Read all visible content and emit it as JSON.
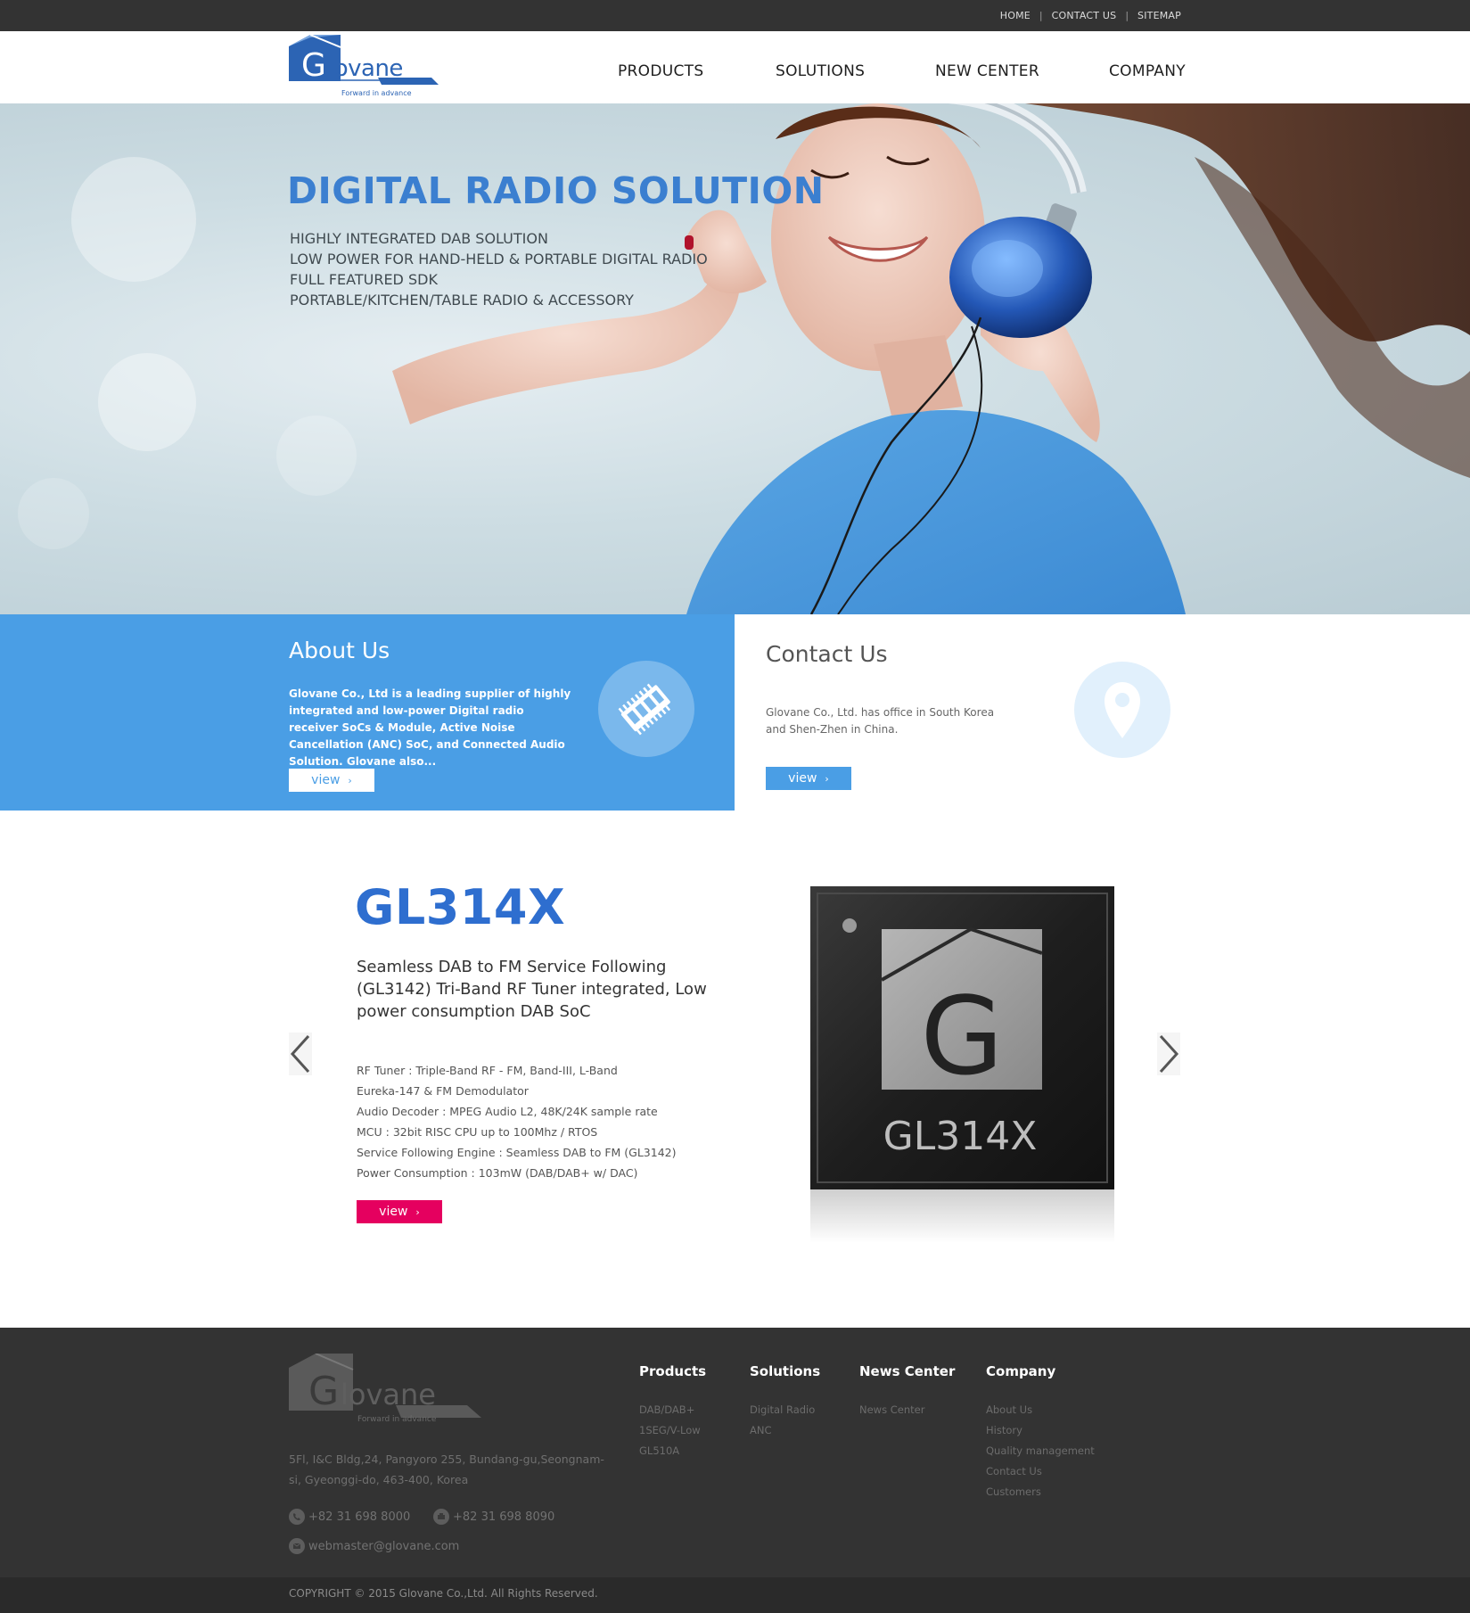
{
  "utility_nav": {
    "home": "HOME",
    "contact": "CONTACT US",
    "sitemap": "SITEMAP",
    "separator": "|"
  },
  "brand": {
    "name": "Glovane",
    "tagline": "Forward in advance",
    "primary_color": "#2c64b4",
    "accent_color": "#4a9ee5"
  },
  "main_nav": [
    "PRODUCTS",
    "SOLUTIONS",
    "NEW CENTER",
    "COMPANY"
  ],
  "hero": {
    "title": "DIGITAL RADIO SOLUTION",
    "lines": [
      "HIGHLY INTEGRATED DAB SOLUTION",
      "LOW POWER FOR HAND-HELD & PORTABLE DIGITAL RADIO",
      "FULL FEATURED SDK",
      "PORTABLE/KITCHEN/TABLE RADIO & ACCESSORY"
    ]
  },
  "about": {
    "title": "About Us",
    "text": "Glovane Co., Ltd is a leading supplier of highly integrated and low-power Digital radio receiver SoCs & Module, Active Noise Cancellation (ANC) SoC, and Connected Audio Solution. Glovane also...",
    "button": "view",
    "button_arrow": "›",
    "icon": "memory-chip-icon"
  },
  "contact": {
    "title": "Contact Us",
    "text": "Glovane Co., Ltd. has office in South Korea and Shen-Zhen in China.",
    "button": "view",
    "button_arrow": "›",
    "icon": "location-pin-icon"
  },
  "product": {
    "title": "GL314X",
    "subtitle": "Seamless DAB to FM Service Following (GL3142) Tri-Band RF Tuner integrated, Low power consumption DAB SoC",
    "specs": [
      "RF Tuner : Triple-Band RF - FM, Band-III, L-Band",
      "Eureka-147 & FM Demodulator",
      "Audio Decoder : MPEG Audio L2, 48K/24K sample rate",
      "MCU : 32bit RISC CPU up to 100Mhz / RTOS",
      "Service Following Engine : Seamless DAB to FM (GL3142)",
      "Power Consumption : 103mW (DAB/DAB+ w/ DAC)"
    ],
    "button": "view",
    "button_arrow": "›",
    "button_color": "#e5005f",
    "chip_label": "GL314X",
    "chip_logo_letter": "G"
  },
  "footer": {
    "logo_name": "Glovane",
    "logo_tagline": "Forward in advance",
    "address": "5Fl, I&C Bldg,24, Pangyoro 255, Bundang-gu,Seongnam-si, Gyeonggi-do, 463-400, Korea",
    "phone": "+82 31 698 8000",
    "fax": "+82 31 698 8090",
    "email": "webmaster@glovane.com",
    "columns": [
      {
        "title": "Products",
        "items": [
          "DAB/DAB+",
          "1SEG/V-Low",
          "GL510A"
        ]
      },
      {
        "title": "Solutions",
        "items": [
          "Digital Radio",
          "ANC"
        ]
      },
      {
        "title": "News Center",
        "items": [
          "News Center"
        ]
      },
      {
        "title": "Company",
        "items": [
          "About Us",
          "History",
          "Quality management",
          "Contact Us",
          "Customers"
        ]
      }
    ],
    "copyright": "COPYRIGHT © 2015 Glovane Co.,Ltd. All Rights Reserved."
  }
}
